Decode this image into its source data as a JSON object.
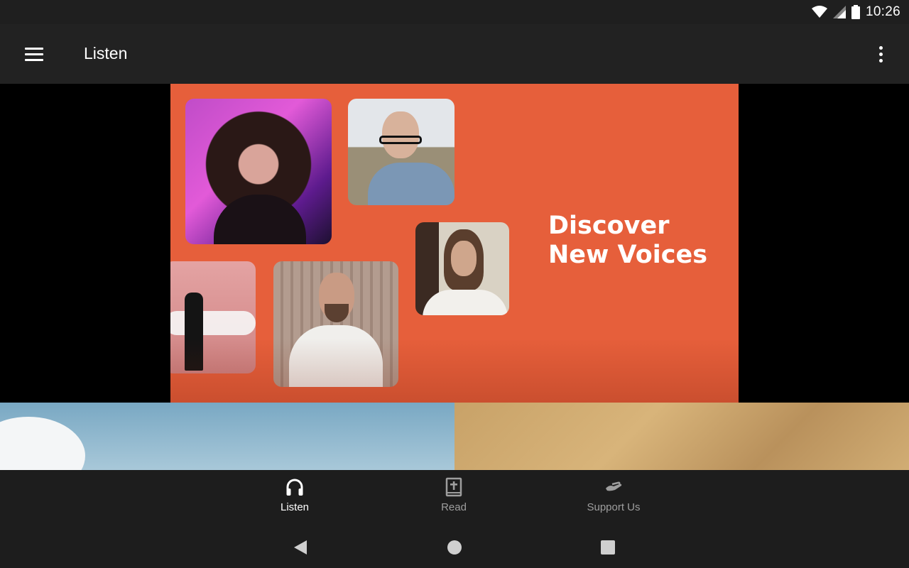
{
  "status_bar": {
    "time": "10:26",
    "icons": [
      "wifi-icon",
      "cell-signal-icon",
      "battery-icon"
    ]
  },
  "app_bar": {
    "title": "Listen",
    "menu_icon": "hamburger-menu-icon",
    "overflow_icon": "more-vertical-icon"
  },
  "banner": {
    "heading_line1": "Discover",
    "heading_line2": "New Voices",
    "background_color": "#e65f3b"
  },
  "bottom_nav": {
    "items": [
      {
        "label": "Listen",
        "icon": "headphones-icon",
        "active": true
      },
      {
        "label": "Read",
        "icon": "bible-icon",
        "active": false
      },
      {
        "label": "Support Us",
        "icon": "giving-hand-icon",
        "active": false
      }
    ]
  },
  "system_nav": {
    "buttons": [
      "back-icon",
      "home-icon",
      "recents-icon"
    ]
  }
}
